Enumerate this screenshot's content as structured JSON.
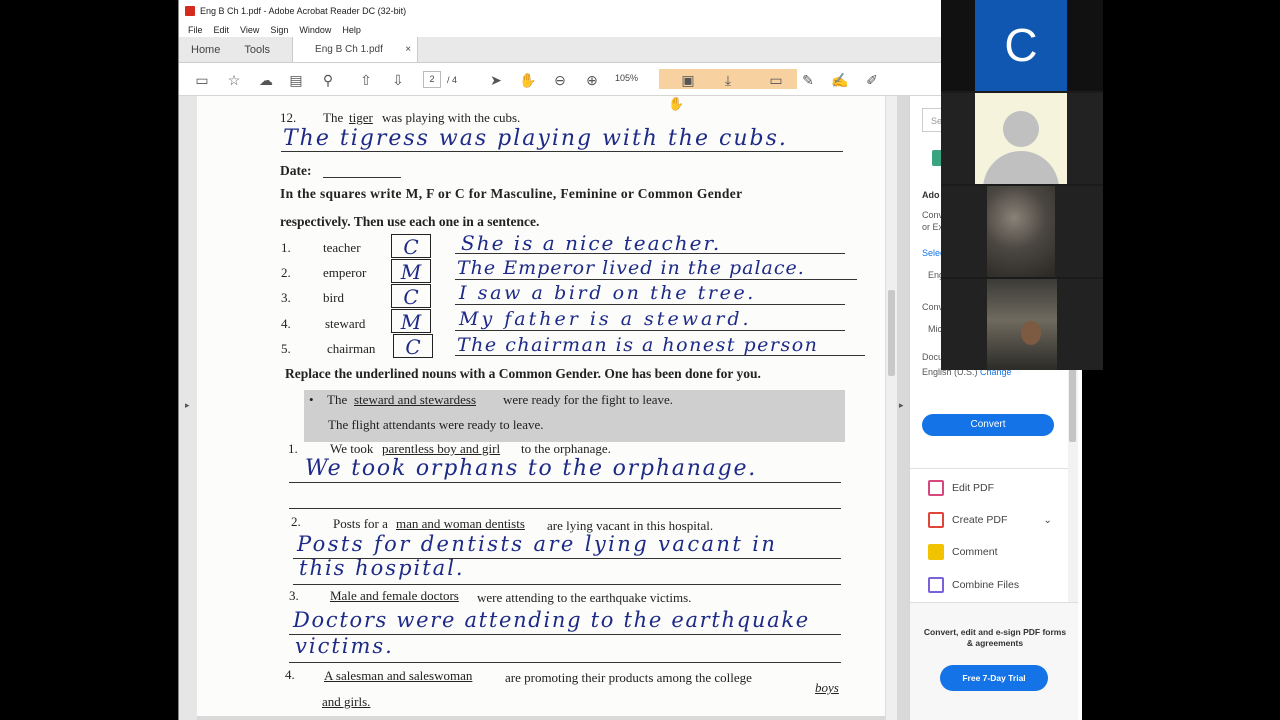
{
  "window": {
    "title": "Eng B Ch 1.pdf - Adobe Acrobat Reader DC (32-bit)",
    "menu": [
      "File",
      "Edit",
      "View",
      "Sign",
      "Window",
      "Help"
    ],
    "nav_tabs": [
      "Home",
      "Tools"
    ],
    "doc_tab": "Eng B Ch 1.pdf",
    "doc_tab_close": "×"
  },
  "toolbar": {
    "current_page": "2",
    "total_pages": "/ 4",
    "zoom": "105%"
  },
  "document": {
    "q12_num": "12.",
    "q12_pre": "The",
    "q12_underlined": "tiger",
    "q12_post": "was playing with the cubs.",
    "q12_answer": "The tigress was playing with the cubs.",
    "date_label": "Date:",
    "instr1": "In the squares write M, F or C for Masculine, Feminine or Common Gender",
    "instr2": "respectively. Then use each one in a sentence.",
    "gender_rows": [
      {
        "num": "1.",
        "word": "teacher",
        "gender": "C",
        "sentence": "She is a nice teacher."
      },
      {
        "num": "2.",
        "word": "emperor",
        "gender": "M",
        "sentence": "The Emperor lived in the palace."
      },
      {
        "num": "3.",
        "word": "bird",
        "gender": "C",
        "sentence": "I saw a bird on the tree."
      },
      {
        "num": "4.",
        "word": "steward",
        "gender": "M",
        "sentence": "My father is a steward."
      },
      {
        "num": "5.",
        "word": "chairman",
        "gender": "C",
        "sentence": "The chairman is a honest person"
      }
    ],
    "replace_heading": "Replace the underlined nouns with a Common Gender. One has been done for you.",
    "example_bullet": "•",
    "example_pre": "The",
    "example_underlined": "steward and stewardess",
    "example_post": "were ready for the fight to leave.",
    "example_answer": "The flight attendants were ready to leave.",
    "r1_num": "1.",
    "r1_pre": "We took",
    "r1_underlined": "parentless boy and girl",
    "r1_post": "to the orphanage.",
    "r1_answer": "We took orphans to the orphanage.",
    "r2_num": "2.",
    "r2_pre": "Posts for a",
    "r2_underlined": "man and woman dentists",
    "r2_post": "are lying vacant in this hospital.",
    "r2_answer_line1": "Posts for dentists are lying vacant in",
    "r2_answer_line2": "this hospital.",
    "r3_num": "3.",
    "r3_underlined": "Male and female doctors",
    "r3_post": "were attending to the earthquake victims.",
    "r3_answer_line1": "Doctors were attending to the earthquake",
    "r3_answer_line2": "victims.",
    "r4_num": "4.",
    "r4_underlined": "A salesman and saleswoman",
    "r4_post": "are promoting their products among the college",
    "r4_underlined_end": "boys",
    "r4_line2": "and girls."
  },
  "right_pane": {
    "search_placeholder": "Se",
    "export_title": "Ado",
    "export_desc1": "Conv",
    "export_desc2": "or Ex",
    "select_label": "Selec",
    "select_value": "Eng",
    "convert_to": "Conv",
    "format_value": "Mic",
    "doc_lang_label": "Docu",
    "doc_lang": "English (U.S.)",
    "change_link": "Change",
    "convert_button": "Convert",
    "tools": [
      {
        "label": "Edit PDF",
        "icon": "edit-pdf-icon",
        "color": "#d5497f"
      },
      {
        "label": "Create PDF",
        "icon": "create-pdf-icon",
        "color": "#e0453a"
      },
      {
        "label": "Comment",
        "icon": "comment-icon",
        "color": "#f2c300"
      },
      {
        "label": "Combine Files",
        "icon": "combine-files-icon",
        "color": "#7b61d9"
      }
    ],
    "promo_text": "Convert, edit and e-sign PDF forms & agreements",
    "trial_button": "Free 7-Day Trial"
  },
  "video": {
    "tile1_initial": "C"
  }
}
